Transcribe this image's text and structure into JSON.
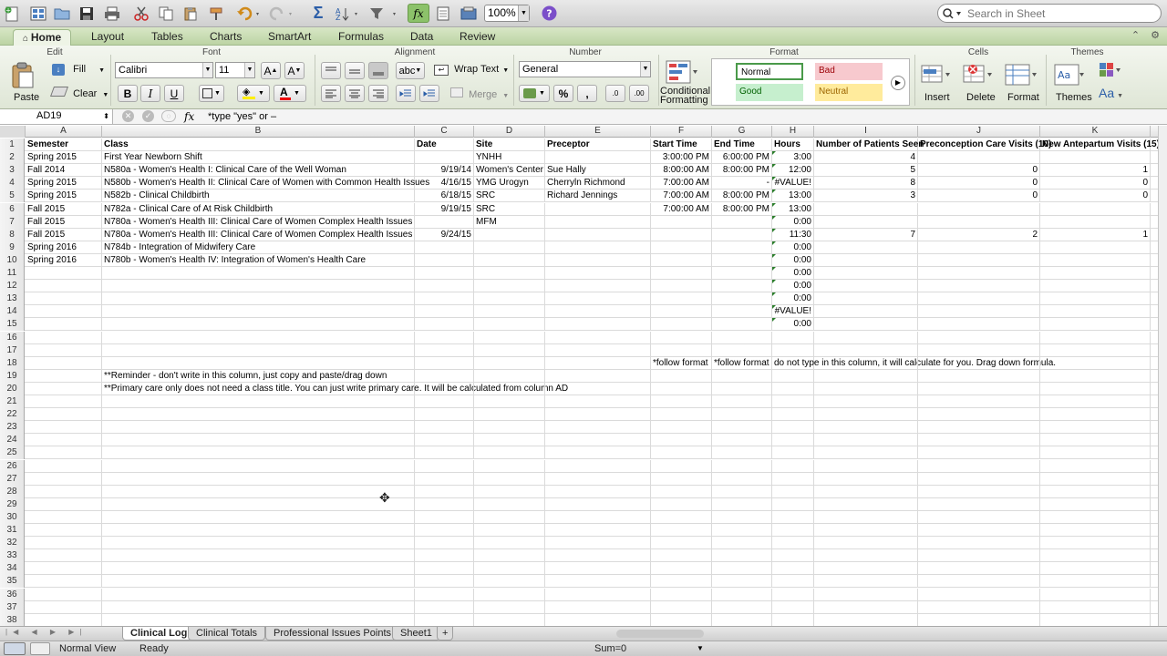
{
  "toolbar": {
    "zoom": "100%",
    "search_placeholder": "Search in Sheet"
  },
  "tabs": [
    "Home",
    "Layout",
    "Tables",
    "Charts",
    "SmartArt",
    "Formulas",
    "Data",
    "Review"
  ],
  "ribbon": {
    "groups": [
      "Edit",
      "Font",
      "Alignment",
      "Number",
      "Format",
      "Cells",
      "Themes"
    ],
    "paste": "Paste",
    "fill": "Fill",
    "clear": "Clear",
    "font_name": "Calibri",
    "font_size": "11",
    "bold": "B",
    "italic": "I",
    "underline": "U",
    "wrap_text": "Wrap Text",
    "merge": "Merge",
    "number_format": "General",
    "cond_fmt": [
      "Conditional",
      "Formatting"
    ],
    "styles": {
      "normal": "Normal",
      "bad": "Bad",
      "good": "Good",
      "neutral": "Neutral"
    },
    "insert": "Insert",
    "delete": "Delete",
    "format": "Format",
    "themes": "Themes",
    "colors": {
      "bad_bg": "#f7c9ce",
      "bad_fg": "#9c0006",
      "good_bg": "#c6efce",
      "good_fg": "#006100",
      "neutral_bg": "#ffeb9c",
      "neutral_fg": "#9c6500"
    }
  },
  "formula_bar": {
    "cell_ref": "AD19",
    "fx": "fx",
    "formula": "*type \"yes\"  or –"
  },
  "columns": [
    "A",
    "B",
    "C",
    "D",
    "E",
    "F",
    "G",
    "H",
    "I",
    "J",
    "K"
  ],
  "rows": [
    [
      "1",
      "Semester",
      "Class",
      "Date",
      "Site",
      "Preceptor",
      "Start Time",
      "End Time",
      "Hours",
      "Number of Patients Seen",
      "Preconception Care Visits (10)",
      "New Antepartum Visits (15)"
    ],
    [
      "2",
      "Spring 2015",
      "First Year Newborn Shift",
      "",
      "YNHH",
      "",
      "3:00:00 PM",
      "6:00:00 PM",
      "3:00",
      "4",
      "",
      ""
    ],
    [
      "3",
      "Fall 2014",
      "N580a - Women's Health I: Clinical Care of the Well Woman",
      "9/19/14",
      "Women's Center",
      "Sue Hally",
      "8:00:00 AM",
      "8:00:00 PM",
      "12:00",
      "5",
      "0",
      "1"
    ],
    [
      "4",
      "Spring 2015",
      "N580b - Women's Health II: Clinical Care of Women with Common Health Issues",
      "4/16/15",
      "YMG Urogyn",
      "Cherryln Richmond",
      "7:00:00 AM",
      "-",
      "#VALUE!",
      "8",
      "0",
      "0"
    ],
    [
      "5",
      "Spring 2015",
      "N582b - Clinical Childbirth",
      "6/18/15",
      "SRC",
      "Richard Jennings",
      "7:00:00 AM",
      "8:00:00 PM",
      "13:00",
      "3",
      "0",
      "0"
    ],
    [
      "6",
      "Fall 2015",
      "N782a - Clinical Care of At Risk Childbirth",
      "9/19/15",
      "SRC",
      "",
      "7:00:00 AM",
      "8:00:00 PM",
      "13:00",
      "",
      "",
      ""
    ],
    [
      "7",
      "Fall 2015",
      "N780a - Women's Health III: Clinical Care of Women Complex Health Issues",
      "",
      "MFM",
      "",
      "",
      "",
      "0:00",
      "",
      "",
      ""
    ],
    [
      "8",
      "Fall 2015",
      "N780a - Women's Health III: Clinical Care of Women Complex Health Issues",
      "9/24/15",
      "",
      "",
      "",
      "",
      "11:30",
      "7",
      "2",
      "1"
    ],
    [
      "9",
      "Spring 2016",
      "N784b - Integration of Midwifery Care",
      "",
      "",
      "",
      "",
      "",
      "0:00",
      "",
      "",
      ""
    ],
    [
      "10",
      "Spring 2016",
      "N780b - Women's Health IV: Integration of Women's Health Care",
      "",
      "",
      "",
      "",
      "",
      "0:00",
      "",
      "",
      ""
    ],
    [
      "11",
      "",
      "",
      "",
      "",
      "",
      "",
      "",
      "0:00",
      "",
      "",
      ""
    ],
    [
      "12",
      "",
      "",
      "",
      "",
      "",
      "",
      "",
      "0:00",
      "",
      "",
      ""
    ],
    [
      "13",
      "",
      "",
      "",
      "",
      "",
      "",
      "",
      "0:00",
      "",
      "",
      ""
    ],
    [
      "14",
      "",
      "",
      "",
      "",
      "",
      "",
      "",
      "#VALUE!",
      "",
      "",
      ""
    ],
    [
      "15",
      "",
      "",
      "",
      "",
      "",
      "",
      "",
      "0:00",
      "",
      "",
      ""
    ],
    [
      "16",
      "",
      "",
      "",
      "",
      "",
      "",
      "",
      "",
      "",
      "",
      ""
    ],
    [
      "17",
      "",
      "",
      "",
      "",
      "",
      "",
      "",
      "",
      "",
      "",
      ""
    ],
    [
      "18",
      "",
      "",
      "",
      "",
      "",
      "*follow format",
      "*follow format",
      "do not type in this column, it will calculate for you. Drag down formula.",
      "",
      "",
      ""
    ],
    [
      "19",
      "",
      "**Reminder - don't write in this column, just copy and paste/drag down",
      "",
      "",
      "",
      "",
      "",
      "",
      "",
      "",
      ""
    ],
    [
      "20",
      "",
      "**Primary care only does not need a class title. You can just write primary care. It will be calculated from column AD",
      "",
      "",
      "",
      "",
      "",
      "",
      "",
      "",
      ""
    ],
    [
      "21"
    ],
    [
      "22"
    ],
    [
      "23"
    ],
    [
      "24"
    ],
    [
      "25"
    ],
    [
      "26"
    ],
    [
      "27"
    ],
    [
      "28"
    ],
    [
      "29"
    ],
    [
      "30"
    ],
    [
      "31"
    ],
    [
      "32"
    ],
    [
      "33"
    ],
    [
      "34"
    ],
    [
      "35"
    ],
    [
      "36"
    ],
    [
      "37"
    ],
    [
      "38"
    ]
  ],
  "sheets": [
    "Clinical Log",
    "Clinical Totals",
    "Professional Issues Points",
    "Sheet1"
  ],
  "add_sheet": "+",
  "status": {
    "view": "Normal View",
    "state": "Ready",
    "sum": "Sum=0"
  }
}
